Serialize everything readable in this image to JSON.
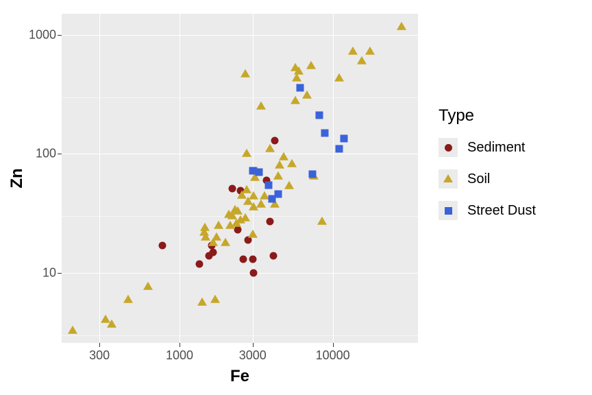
{
  "chart_data": {
    "type": "scatter",
    "xlabel": "Fe",
    "ylabel": "Zn",
    "xscale": "log10",
    "yscale": "log10",
    "xlim": [
      170,
      36000
    ],
    "ylim": [
      2.6,
      1500
    ],
    "x_ticks": [
      300,
      1000,
      3000,
      10000
    ],
    "y_ticks": [
      10,
      100,
      1000
    ],
    "legend_title": "Type",
    "series": [
      {
        "name": "Sediment",
        "shape": "circle",
        "color": "#8b1a1a",
        "points": [
          {
            "x": 770,
            "y": 17
          },
          {
            "x": 1350,
            "y": 12
          },
          {
            "x": 1550,
            "y": 14
          },
          {
            "x": 1630,
            "y": 17
          },
          {
            "x": 1650,
            "y": 15
          },
          {
            "x": 2200,
            "y": 51
          },
          {
            "x": 2400,
            "y": 23
          },
          {
            "x": 2500,
            "y": 49
          },
          {
            "x": 2600,
            "y": 13
          },
          {
            "x": 2800,
            "y": 19
          },
          {
            "x": 3000,
            "y": 13
          },
          {
            "x": 3050,
            "y": 10
          },
          {
            "x": 3700,
            "y": 60
          },
          {
            "x": 3900,
            "y": 27
          },
          {
            "x": 4100,
            "y": 14
          },
          {
            "x": 4200,
            "y": 130
          }
        ]
      },
      {
        "name": "Soil",
        "shape": "triangle",
        "color": "#c7a72a",
        "points": [
          {
            "x": 200,
            "y": 3.3
          },
          {
            "x": 330,
            "y": 4.1
          },
          {
            "x": 360,
            "y": 3.7
          },
          {
            "x": 460,
            "y": 6.0
          },
          {
            "x": 620,
            "y": 7.7
          },
          {
            "x": 1400,
            "y": 5.7
          },
          {
            "x": 1450,
            "y": 22
          },
          {
            "x": 1460,
            "y": 24
          },
          {
            "x": 1480,
            "y": 20
          },
          {
            "x": 1650,
            "y": 18
          },
          {
            "x": 1700,
            "y": 6.0
          },
          {
            "x": 1750,
            "y": 20
          },
          {
            "x": 1800,
            "y": 25
          },
          {
            "x": 2000,
            "y": 18
          },
          {
            "x": 2100,
            "y": 31
          },
          {
            "x": 2150,
            "y": 25
          },
          {
            "x": 2200,
            "y": 30
          },
          {
            "x": 2300,
            "y": 34
          },
          {
            "x": 2350,
            "y": 26
          },
          {
            "x": 2400,
            "y": 33
          },
          {
            "x": 2500,
            "y": 28
          },
          {
            "x": 2550,
            "y": 45
          },
          {
            "x": 2700,
            "y": 470
          },
          {
            "x": 2700,
            "y": 29
          },
          {
            "x": 2750,
            "y": 100
          },
          {
            "x": 2750,
            "y": 50
          },
          {
            "x": 2800,
            "y": 40
          },
          {
            "x": 3000,
            "y": 21
          },
          {
            "x": 3050,
            "y": 36
          },
          {
            "x": 3050,
            "y": 44
          },
          {
            "x": 3100,
            "y": 63
          },
          {
            "x": 3200,
            "y": 71
          },
          {
            "x": 3400,
            "y": 38
          },
          {
            "x": 3400,
            "y": 250
          },
          {
            "x": 3600,
            "y": 44
          },
          {
            "x": 3900,
            "y": 110
          },
          {
            "x": 4200,
            "y": 38
          },
          {
            "x": 4400,
            "y": 65
          },
          {
            "x": 4500,
            "y": 80
          },
          {
            "x": 4800,
            "y": 94
          },
          {
            "x": 5200,
            "y": 54
          },
          {
            "x": 5400,
            "y": 83
          },
          {
            "x": 5700,
            "y": 525
          },
          {
            "x": 5700,
            "y": 280
          },
          {
            "x": 5800,
            "y": 430
          },
          {
            "x": 6000,
            "y": 490
          },
          {
            "x": 6800,
            "y": 310
          },
          {
            "x": 7200,
            "y": 545
          },
          {
            "x": 7500,
            "y": 65
          },
          {
            "x": 8500,
            "y": 27
          },
          {
            "x": 11000,
            "y": 430
          },
          {
            "x": 13500,
            "y": 720
          },
          {
            "x": 15500,
            "y": 600
          },
          {
            "x": 17500,
            "y": 720
          },
          {
            "x": 28000,
            "y": 1170
          }
        ]
      },
      {
        "name": "Street Dust",
        "shape": "square",
        "color": "#3a62d9",
        "points": [
          {
            "x": 3000,
            "y": 72
          },
          {
            "x": 3300,
            "y": 70
          },
          {
            "x": 3800,
            "y": 55
          },
          {
            "x": 4000,
            "y": 42
          },
          {
            "x": 4400,
            "y": 46
          },
          {
            "x": 6100,
            "y": 360
          },
          {
            "x": 7400,
            "y": 68
          },
          {
            "x": 8200,
            "y": 210
          },
          {
            "x": 8900,
            "y": 150
          },
          {
            "x": 11000,
            "y": 110
          },
          {
            "x": 11800,
            "y": 135
          }
        ]
      }
    ]
  },
  "tick_labels": {
    "x": [
      "300",
      "1000",
      "3000",
      "10000"
    ],
    "y": [
      "10",
      "100",
      "1000"
    ]
  }
}
